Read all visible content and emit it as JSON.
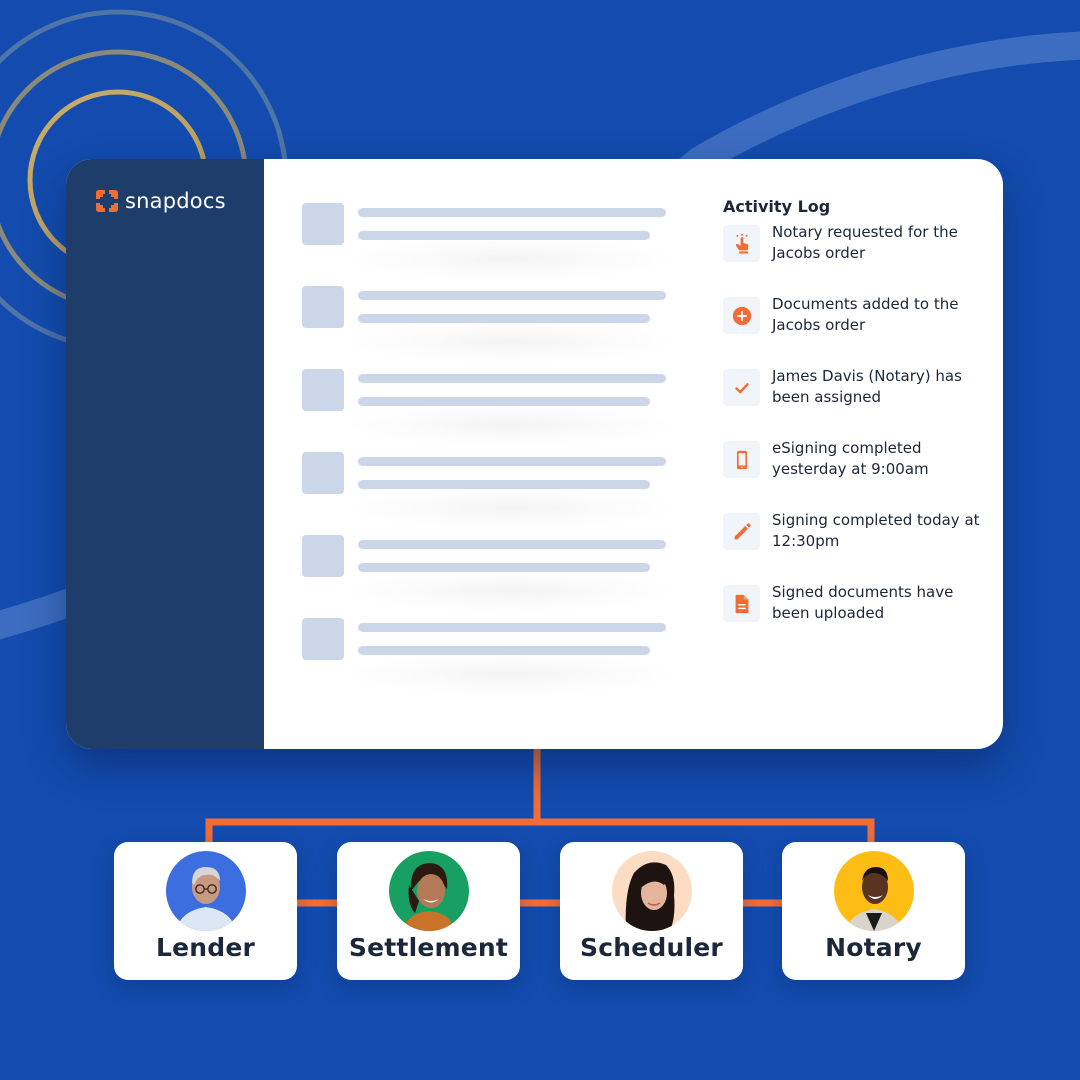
{
  "brand": {
    "name": "snapdocs",
    "accent_color": "#f26d35",
    "background_color": "#134cae",
    "sidebar_color": "#1f3d6b"
  },
  "activity_log": {
    "title": "Activity Log",
    "items": [
      {
        "icon": "tap-hand-icon",
        "text": "Notary requested for the Jacobs order"
      },
      {
        "icon": "plus-circle-icon",
        "text": "Documents added to the Jacobs order"
      },
      {
        "icon": "checkmark-icon",
        "text": "James Davis (Notary) has been assigned"
      },
      {
        "icon": "mobile-phone-icon",
        "text": "eSigning completed yesterday at 9:00am"
      },
      {
        "icon": "pencil-icon",
        "text": "Signing completed today at 12:30pm"
      },
      {
        "icon": "document-icon",
        "text": "Signed documents have been uploaded"
      }
    ]
  },
  "skeleton_rows": 6,
  "roles": [
    {
      "label": "Lender",
      "avatar_bg": "#3d6ee0"
    },
    {
      "label": "Settlement",
      "avatar_bg": "#17a062"
    },
    {
      "label": "Scheduler",
      "avatar_bg": "#fcdcc3"
    },
    {
      "label": "Notary",
      "avatar_bg": "#fdbd14"
    }
  ]
}
